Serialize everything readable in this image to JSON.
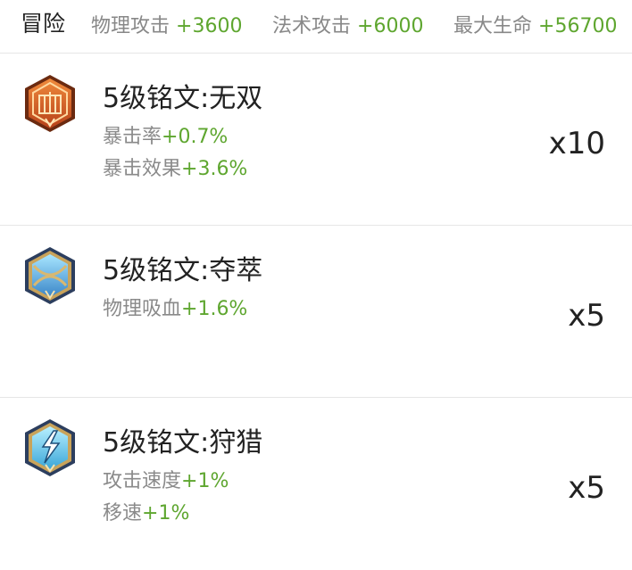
{
  "header": {
    "title": "冒险",
    "stats": [
      {
        "label": "物理攻击",
        "value": "+3600"
      },
      {
        "label": "法术攻击",
        "value": "+6000"
      },
      {
        "label": "最大生命",
        "value": "+56700"
      }
    ]
  },
  "inscriptions": [
    {
      "name": "5级铭文:无双",
      "icon": "orange-inscription-icon",
      "count": "x10",
      "attrs": [
        {
          "label": "暴击率",
          "value": "+0.7%"
        },
        {
          "label": "暴击效果",
          "value": "+3.6%"
        }
      ]
    },
    {
      "name": "5级铭文:夺萃",
      "icon": "blue-inscription-icon",
      "count": "x5",
      "attrs": [
        {
          "label": "物理吸血",
          "value": "+1.6%"
        }
      ]
    },
    {
      "name": "5级铭文:狩猎",
      "icon": "blue-lightning-inscription-icon",
      "count": "x5",
      "attrs": [
        {
          "label": "攻击速度",
          "value": "+1%"
        },
        {
          "label": "移速",
          "value": "+1%"
        }
      ]
    }
  ],
  "colors": {
    "accent_green": "#5ea62f",
    "label_gray": "#888888",
    "divider": "#e6e6e6"
  }
}
